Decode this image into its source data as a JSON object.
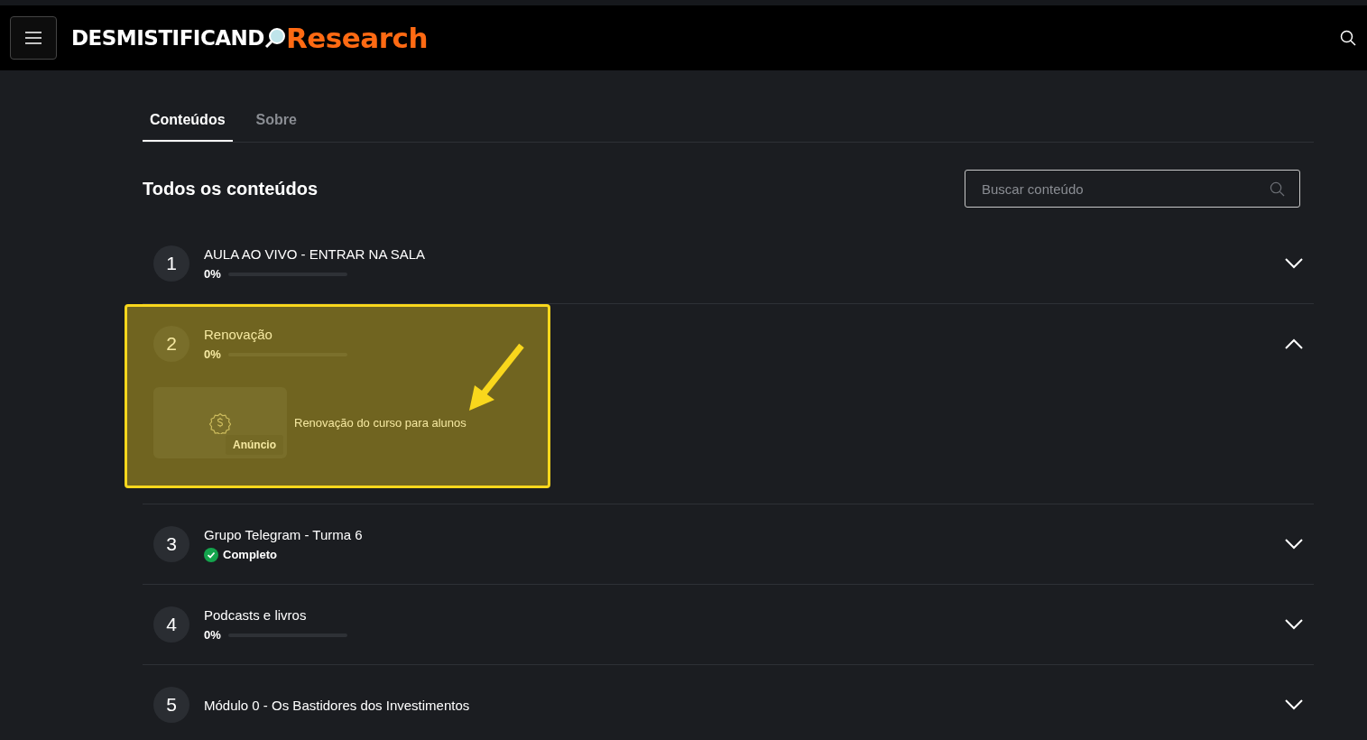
{
  "header": {
    "logo": {
      "brand": "DESMISTIFICAND",
      "accent": "Research"
    }
  },
  "tabs": [
    {
      "label": "Conteúdos",
      "selected": true
    },
    {
      "label": "Sobre",
      "selected": false
    }
  ],
  "heading": "Todos os conteúdos",
  "search": {
    "placeholder": "Buscar conteúdo"
  },
  "modules": [
    {
      "number": "1",
      "title": "AULA AO VIVO - ENTRAR NA SALA",
      "kind": "progress",
      "progress": "0%",
      "level": 0,
      "expanded": false,
      "highlighted": false
    },
    {
      "number": "2",
      "title": "Renovação",
      "kind": "progress",
      "progress": "0%",
      "level": 0,
      "expanded": true,
      "highlighted": true,
      "lessons": [
        {
          "title": "Renovação do curso para alunos",
          "badge": "Anúncio"
        }
      ]
    },
    {
      "number": "3",
      "title": "Grupo Telegram - Turma 6",
      "kind": "complete",
      "progress": "Completo",
      "expanded": false,
      "highlighted": false
    },
    {
      "number": "4",
      "title": "Podcasts e livros",
      "kind": "progress",
      "progress": "0%",
      "level": 0,
      "expanded": false,
      "highlighted": false
    },
    {
      "number": "5",
      "title": "Módulo 0 - Os Bastidores dos Investimentos",
      "kind": "cut",
      "expanded": false,
      "highlighted": false
    }
  ]
}
